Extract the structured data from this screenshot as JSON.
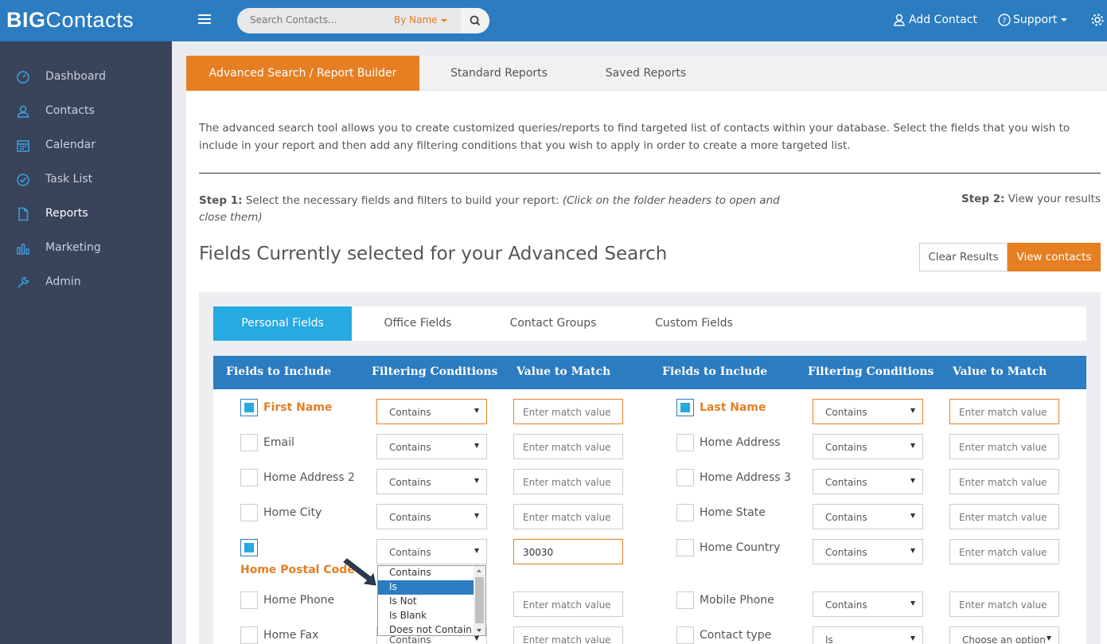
{
  "app": {
    "logo_bold": "BIG",
    "logo_thin": "Contacts"
  },
  "header": {
    "search_placeholder": "Search Contacts...",
    "search_by": "By Name",
    "add_contact": "Add Contact",
    "support": "Support"
  },
  "sidebar": {
    "items": [
      {
        "label": "Dashboard",
        "icon": "dashboard-icon"
      },
      {
        "label": "Contacts",
        "icon": "user-icon"
      },
      {
        "label": "Calendar",
        "icon": "calendar-icon"
      },
      {
        "label": "Task List",
        "icon": "check-circle-icon"
      },
      {
        "label": "Reports",
        "icon": "document-icon",
        "active": true
      },
      {
        "label": "Marketing",
        "icon": "bar-chart-icon"
      },
      {
        "label": "Admin",
        "icon": "wrench-icon"
      }
    ]
  },
  "tabs": [
    "Advanced Search / Report Builder",
    "Standard Reports",
    "Saved Reports"
  ],
  "intro": "The advanced search tool allows you to create customized queries/reports to find targeted list of contacts within your database. Select the fields that you wish to include in your report and then add any filtering conditions that you wish to apply in order to create a more targeted list.",
  "step1": {
    "label": "Step 1:",
    "text": " Select the necessary fields and filters to build your report: ",
    "hint": "(Click on the folder headers to open and close them)"
  },
  "step2": {
    "label": "Step 2:",
    "text": " View your results"
  },
  "fields_title": "Fields Currently selected for your Advanced Search",
  "buttons": {
    "clear": "Clear Results",
    "view": "View contacts"
  },
  "subtabs": [
    "Personal Fields",
    "Office Fields",
    "Contact Groups",
    "Custom Fields"
  ],
  "grid": {
    "headers": [
      "Fields to Include",
      "Filtering Conditions",
      "Value to Match",
      "Fields to Include",
      "Filtering Conditions",
      "Value to Match"
    ],
    "input_placeholder": "Enter match value",
    "left_rows": [
      {
        "field": "First Name",
        "checked": true,
        "condition": "Contains",
        "value": ""
      },
      {
        "field": "Email",
        "checked": false,
        "condition": "Contains",
        "value": ""
      },
      {
        "field": "Home Address 2",
        "checked": false,
        "condition": "Contains",
        "value": ""
      },
      {
        "field": "Home City",
        "checked": false,
        "condition": "Contains",
        "value": ""
      },
      {
        "field": "Home Postal Code",
        "checked": true,
        "condition": "Contains",
        "value": "30030"
      },
      {
        "field": "Home Phone",
        "checked": false,
        "condition": "",
        "value": ""
      },
      {
        "field": "Home Fax",
        "checked": false,
        "condition": "Contains",
        "value": ""
      }
    ],
    "right_rows": [
      {
        "field": "Last Name",
        "checked": true,
        "condition": "Contains",
        "value": ""
      },
      {
        "field": "Home Address",
        "checked": false,
        "condition": "Contains",
        "value": ""
      },
      {
        "field": "Home Address 3",
        "checked": false,
        "condition": "Contains",
        "value": ""
      },
      {
        "field": "Home State",
        "checked": false,
        "condition": "Contains",
        "value": ""
      },
      {
        "field": "Home Country",
        "checked": false,
        "condition": "Contains",
        "value": ""
      },
      {
        "field": "Mobile Phone",
        "checked": false,
        "condition": "Contains",
        "value": ""
      },
      {
        "field": "Contact type",
        "checked": false,
        "condition": "Is",
        "value": "Choose an option"
      }
    ],
    "dropdown_options": [
      "Contains",
      "Is",
      "Is Not",
      "Is Blank",
      "Does not Contain"
    ],
    "dropdown_highlighted": "Is"
  },
  "colors": {
    "brand_blue": "#2b7cc1",
    "accent_orange": "#e67e22",
    "active_subtab": "#27a9e1",
    "sidebar_bg": "#394359"
  }
}
